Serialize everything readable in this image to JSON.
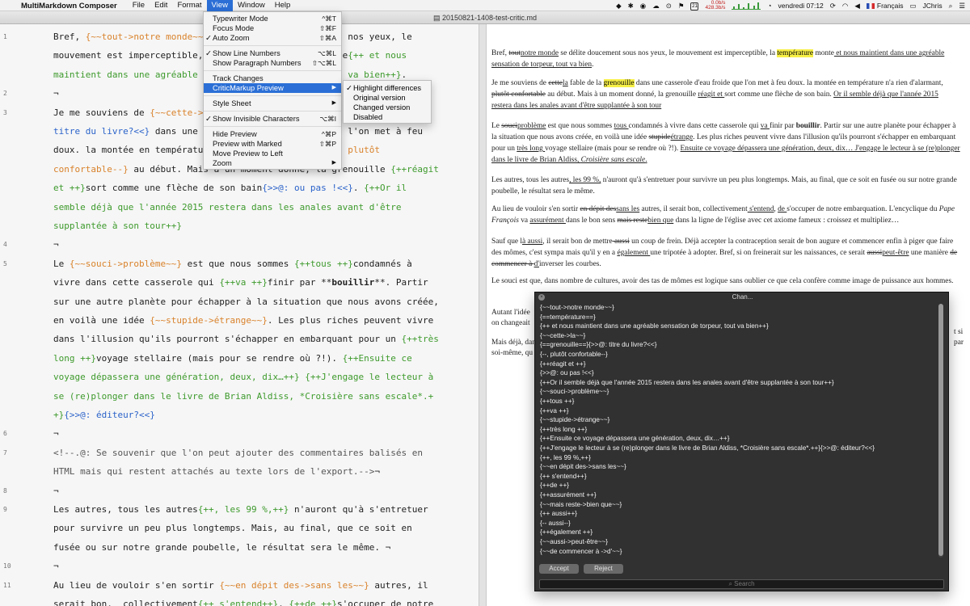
{
  "menubar": {
    "apple_icon": "apple-icon",
    "app_name": "MultiMarkdown Composer",
    "items": [
      "File",
      "Edit",
      "Format",
      "View",
      "Window",
      "Help"
    ],
    "active_item": "View",
    "net_down": "0.0b/s",
    "net_up": "428.3b/s",
    "calendar_day": "21",
    "clock": "vendredi 07:12",
    "language": "Français",
    "user": "JChris"
  },
  "window": {
    "title": "20150821-1408-test-critic.md",
    "file_icon": "document-icon"
  },
  "editor": {
    "lines": [
      {
        "n": "1",
        "segs": [
          [
            "t",
            "Bref, "
          ],
          [
            "o",
            "{~~tout->notre monde~~}"
          ],
          [
            "t",
            " se délite doucement sous nos yeux, le"
          ]
        ]
      },
      {
        "segs": [
          [
            "t",
            "mouvement est imperceptible, la "
          ],
          [
            "g",
            "{==température==}"
          ],
          [
            "t",
            " monte"
          ],
          [
            "g",
            "{++ et nous"
          ]
        ]
      },
      {
        "segs": [
          [
            "g",
            "maintient dans une agréable sensation de torpeur, tout va bien++}"
          ],
          [
            "t",
            "."
          ]
        ]
      },
      {
        "n": "2",
        "segs": [
          [
            "t",
            "¬"
          ]
        ]
      },
      {
        "n": "3",
        "segs": [
          [
            "t",
            "Je me souviens de "
          ],
          [
            "o",
            "{~~cette->la~~}"
          ],
          [
            "t",
            " fable de la "
          ],
          [
            "g",
            "{==grenouille==}"
          ],
          [
            "b",
            "{>>@: "
          ]
        ]
      },
      {
        "segs": [
          [
            "b",
            "titre du livre?<<}"
          ],
          [
            "t",
            " dans une casserole d'eau froide que l'on met à feu"
          ]
        ]
      },
      {
        "segs": [
          [
            "t",
            "doux. la montée en température n'a rien d'alarmant"
          ],
          [
            "o",
            "{--, plutôt"
          ]
        ]
      },
      {
        "segs": [
          [
            "o",
            "confortable--}"
          ],
          [
            "t",
            " au début. Mais à un moment donné, la grenouille "
          ],
          [
            "g",
            "{++réagit"
          ]
        ]
      },
      {
        "segs": [
          [
            "g",
            "et ++}"
          ],
          [
            "t",
            "sort comme une flèche de son bain"
          ],
          [
            "b",
            "{>>@: ou pas !<<}"
          ],
          [
            "t",
            ". "
          ],
          [
            "g",
            "{++Or il"
          ]
        ]
      },
      {
        "segs": [
          [
            "g",
            "semble déjà que l'année 2015 restera dans les anales avant d'être"
          ]
        ]
      },
      {
        "segs": [
          [
            "g",
            "supplantée à son tour++}"
          ]
        ]
      },
      {
        "n": "4",
        "segs": [
          [
            "t",
            "¬"
          ]
        ]
      },
      {
        "n": "5",
        "segs": [
          [
            "t",
            "Le "
          ],
          [
            "o",
            "{~~souci->problème~~}"
          ],
          [
            "t",
            " est que nous sommes "
          ],
          [
            "g",
            "{++tous ++}"
          ],
          [
            "t",
            "condamnés à"
          ]
        ]
      },
      {
        "segs": [
          [
            "t",
            "vivre dans cette casserole qui "
          ],
          [
            "g",
            "{++va ++}"
          ],
          [
            "t",
            "finir par **"
          ],
          [
            "k",
            "bouillir"
          ],
          [
            "t",
            "**. Partir"
          ]
        ]
      },
      {
        "segs": [
          [
            "t",
            "sur une autre planète pour échapper à la situation que nous avons créée,"
          ]
        ]
      },
      {
        "segs": [
          [
            "t",
            "en voilà une idée "
          ],
          [
            "o",
            "{~~stupide->étrange~~}"
          ],
          [
            "t",
            ". Les plus riches peuvent vivre"
          ]
        ]
      },
      {
        "segs": [
          [
            "t",
            "dans l'illusion qu'ils pourront s'échapper en embarquant pour un "
          ],
          [
            "g",
            "{++très"
          ]
        ]
      },
      {
        "segs": [
          [
            "g",
            "long ++}"
          ],
          [
            "t",
            "voyage stellaire (mais pour se rendre où ?!). "
          ],
          [
            "g",
            "{++Ensuite ce"
          ]
        ]
      },
      {
        "segs": [
          [
            "g",
            "voyage dépassera une génération, deux, dix…++}"
          ],
          [
            "t",
            " "
          ],
          [
            "g",
            "{++J'engage le lecteur à"
          ]
        ]
      },
      {
        "segs": [
          [
            "g",
            "se (re)plonger dans le livre de Brian Aldiss, *Croisière sans escale*.+"
          ]
        ]
      },
      {
        "segs": [
          [
            "g",
            "+}"
          ],
          [
            "b",
            "{>>@: éditeur?<<}"
          ]
        ]
      },
      {
        "n": "6",
        "segs": [
          [
            "t",
            "¬"
          ]
        ]
      },
      {
        "n": "7",
        "segs": [
          [
            "c",
            "<!--.@: Se souvenir que l'on peut ajouter des commentaires balisés en"
          ]
        ]
      },
      {
        "segs": [
          [
            "c",
            "HTML mais qui restent attachés au texte lors de l'export.-->"
          ],
          [
            "t",
            "¬"
          ]
        ]
      },
      {
        "n": "8",
        "segs": [
          [
            "t",
            "¬"
          ]
        ]
      },
      {
        "n": "9",
        "segs": [
          [
            "t",
            "Les autres, tous les autres"
          ],
          [
            "g",
            "{++, les 99 %,++}"
          ],
          [
            "t",
            " n'auront qu'à s'entretuer"
          ]
        ]
      },
      {
        "segs": [
          [
            "t",
            "pour survivre un peu plus longtemps. Mais, au final, que ce soit en"
          ]
        ]
      },
      {
        "segs": [
          [
            "t",
            "fusée ou sur notre grande poubelle, le résultat sera le même."
          ],
          [
            "t",
            " ¬"
          ]
        ]
      },
      {
        "n": "10",
        "segs": [
          [
            "t",
            "¬"
          ]
        ]
      },
      {
        "n": "11",
        "segs": [
          [
            "t",
            "Au lieu de vouloir s'en sortir "
          ],
          [
            "o",
            "{~~en dépit des->sans les~~}"
          ],
          [
            "t",
            " autres, il"
          ]
        ]
      },
      {
        "segs": [
          [
            "t",
            "serait bon,  collectivement"
          ],
          [
            "g",
            "{++ s'entend++}"
          ],
          [
            "t",
            ", "
          ],
          [
            "g",
            "{++de ++}"
          ],
          [
            "t",
            "s'occuper de notre"
          ]
        ]
      }
    ]
  },
  "preview": {
    "paragraphs": [
      {
        "parts": [
          [
            "t",
            "Bref, "
          ],
          [
            "d",
            "tout"
          ],
          [
            "u",
            "notre monde"
          ],
          [
            "t",
            " se délite doucement sous nos yeux, le mouvement est imperceptible, la "
          ],
          [
            "m",
            "température"
          ],
          [
            "t",
            " monte"
          ],
          [
            "u",
            " et nous maintient dans une agréable sensation de torpeur, tout va bien"
          ],
          [
            "t",
            "."
          ]
        ]
      },
      {
        "parts": [
          [
            "t",
            "Je me souviens de "
          ],
          [
            "d",
            "cette"
          ],
          [
            "u",
            "la"
          ],
          [
            "t",
            " fable de la "
          ],
          [
            "m",
            "grenouille"
          ],
          [
            "t",
            " dans une casserole d'eau froide que l'on met à feu doux. la montée en température n'a rien d'alarmant, "
          ],
          [
            "d",
            "plutôt confortable"
          ],
          [
            "t",
            " au début. Mais à un moment donné, la grenouille "
          ],
          [
            "u",
            "réagit et "
          ],
          [
            "t",
            "sort comme une flèche de son bain. "
          ],
          [
            "u",
            "Or il semble déjà que l'année 2015 restera dans les anales avant d'être supplantée à son tour"
          ]
        ]
      },
      {
        "parts": [
          [
            "t",
            "Le "
          ],
          [
            "d",
            "souci"
          ],
          [
            "u",
            "problème"
          ],
          [
            "t",
            " est que nous sommes "
          ],
          [
            "u",
            "tous "
          ],
          [
            "t",
            "condamnés à vivre dans cette casserole qui "
          ],
          [
            "u",
            "va "
          ],
          [
            "t",
            "finir par "
          ],
          [
            "k",
            "bouillir"
          ],
          [
            "t",
            ". Partir sur une autre planète pour échapper à la situation que nous avons créée, en voilà une idée "
          ],
          [
            "d",
            "stupide"
          ],
          [
            "u",
            "étrange"
          ],
          [
            "t",
            ". Les plus riches peuvent vivre dans l'illusion qu'ils pourront s'échapper en embarquant pour un "
          ],
          [
            "u",
            "très long "
          ],
          [
            "t",
            "voyage stellaire (mais pour se rendre où ?!). "
          ],
          [
            "u",
            "Ensuite ce voyage dépassera une génération, deux, dix… J'engage le lecteur à se (re)plonger dans le livre de Brian Aldiss, "
          ],
          [
            "ui",
            "Croisière sans escale"
          ],
          [
            "u",
            "."
          ]
        ]
      },
      {
        "parts": [
          [
            "t",
            "Les autres, tous les autres"
          ],
          [
            "u",
            ", les 99 %,"
          ],
          [
            "t",
            " n'auront qu'à s'entretuer pour survivre un peu plus longtemps. Mais, au final, que ce soit en fusée ou sur notre grande poubelle, le résultat sera le même."
          ]
        ]
      },
      {
        "parts": [
          [
            "t",
            "Au lieu de vouloir s'en sortir "
          ],
          [
            "d",
            "en dépit des"
          ],
          [
            "u",
            "sans les"
          ],
          [
            "t",
            " autres, il serait bon, collectivement"
          ],
          [
            "u",
            " s'entend"
          ],
          [
            "t",
            ", "
          ],
          [
            "u",
            "de "
          ],
          [
            "t",
            "s'occuper de notre embarquation. L'encyclique du "
          ],
          [
            "i",
            "Pape François"
          ],
          [
            "t",
            " va "
          ],
          [
            "u",
            "assurément "
          ],
          [
            "t",
            "dans le bon sens "
          ],
          [
            "d",
            "mais reste"
          ],
          [
            "u",
            "bien que"
          ],
          [
            "t",
            " dans la ligne de l'église avec cet axiome fameux : croissez et multipliez…"
          ]
        ]
      },
      {
        "parts": [
          [
            "t",
            "Sauf que l"
          ],
          [
            "u",
            "à aussi"
          ],
          [
            "t",
            ", il serait bon de mettre"
          ],
          [
            "d",
            " aussi"
          ],
          [
            "t",
            " un coup de frein. Déjà accepter la contraception serait de bon augure et commencer enfin à piger que faire des mômes, c'est sympa mais qu'il y en a "
          ],
          [
            "u",
            "également "
          ],
          [
            "t",
            "une tripotée à adopter. Bref, si on freinerait sur les naissances, ce serait "
          ],
          [
            "d",
            "aussi"
          ],
          [
            "u",
            "peut-être"
          ],
          [
            "t",
            " une manière "
          ],
          [
            "d",
            "de commencer à "
          ],
          [
            "u",
            "d'"
          ],
          [
            "t",
            "inverser les courbes."
          ]
        ]
      },
      {
        "parts": [
          [
            "t",
            "Le souci est que, dans nombre de cultures, avoir des tas de mômes est logique sans oublier ce que cela confère comme image de puissance aux hommes."
          ]
        ]
      },
      {
        "parts": [
          [
            "t",
            "Autant l'idée"
          ]
        ]
      },
      {
        "parts": [
          [
            "t",
            "on changeait"
          ]
        ]
      },
      {
        "parts": [
          [
            "t",
            "Mais déjà, dan"
          ]
        ]
      },
      {
        "parts": [
          [
            "t",
            "soi-même, qu"
          ]
        ]
      }
    ],
    "clipped_right": [
      "t si",
      "par"
    ]
  },
  "view_menu": {
    "items": [
      {
        "label": "Typewriter Mode",
        "shortcut": "^⌘T",
        "checked": false,
        "submenu": false
      },
      {
        "label": "Focus Mode",
        "shortcut": "⇧⌘F",
        "checked": false,
        "submenu": false
      },
      {
        "label": "Auto Zoom",
        "shortcut": "⇧⌘A",
        "checked": true,
        "submenu": false
      },
      {
        "sep": true
      },
      {
        "label": "Show Line Numbers",
        "shortcut": "⌥⌘L",
        "checked": true,
        "submenu": false
      },
      {
        "label": "Show Paragraph Numbers",
        "shortcut": "⇧⌥⌘L",
        "checked": false,
        "submenu": false
      },
      {
        "sep": true
      },
      {
        "label": "Track Changes",
        "shortcut": "",
        "checked": false,
        "submenu": false
      },
      {
        "label": "CriticMarkup Preview",
        "shortcut": "",
        "checked": false,
        "submenu": true,
        "highlighted": true
      },
      {
        "sep": true
      },
      {
        "label": "Style Sheet",
        "shortcut": "",
        "checked": false,
        "submenu": true
      },
      {
        "sep": true
      },
      {
        "label": "Show Invisible Characters",
        "shortcut": "⌥⌘I",
        "checked": true,
        "submenu": false
      },
      {
        "sep": true
      },
      {
        "label": "Hide Preview",
        "shortcut": "^⌘P",
        "checked": false,
        "submenu": false
      },
      {
        "label": "Preview with Marked",
        "shortcut": "⇧⌘P",
        "checked": false,
        "submenu": false
      },
      {
        "label": "Move Preview to Left",
        "shortcut": "",
        "checked": false,
        "submenu": false
      },
      {
        "label": "Zoom",
        "shortcut": "",
        "checked": false,
        "submenu": true
      }
    ]
  },
  "critic_submenu": {
    "items": [
      {
        "label": "Highlight differences",
        "checked": true
      },
      {
        "label": "Original version",
        "checked": false
      },
      {
        "label": "Changed version",
        "checked": false
      },
      {
        "label": "Disabled",
        "checked": false
      }
    ]
  },
  "changes_panel": {
    "title": "Chan...",
    "items": [
      "{~~tout->notre monde~~}",
      "{==température==}",
      "{++ et nous maintient dans une agréable sensation de torpeur, tout va bien++}",
      "{~~cette->la~~}",
      "{==grenouille==}{>>@: titre du livre?<<}",
      "{--, plutôt confortable--}",
      "{++réagit et ++}",
      "{>>@: ou pas !<<}",
      "{++Or il semble déjà que l'année 2015 restera dans les anales avant d'être supplantée à son tour++}",
      "{~~souci->problème~~}",
      "{++tous ++}",
      "{++va ++}",
      "{~~stupide->étrange~~}",
      "{++très long ++}",
      "{++Ensuite ce voyage dépassera une génération, deux, dix…++}",
      "{++J'engage le lecteur à se (re)plonger dans le livre de Brian Aldiss, *Croisière sans escale*.++}{>>@: éditeur?<<}",
      "{++, les 99 %,++}",
      "{~~en dépit des->sans les~~}",
      "{++ s'entend++}",
      "{++de ++}",
      "{++assurément ++}",
      "{~~mais reste->bien que~~}",
      "{++ aussi++}",
      "{-- aussi--}",
      "{++également  ++}",
      "{~~aussi->peut-être~~}",
      "{~~de commencer à ->d'~~}"
    ],
    "accept_label": "Accept",
    "reject_label": "Reject",
    "search_placeholder": "Search"
  }
}
